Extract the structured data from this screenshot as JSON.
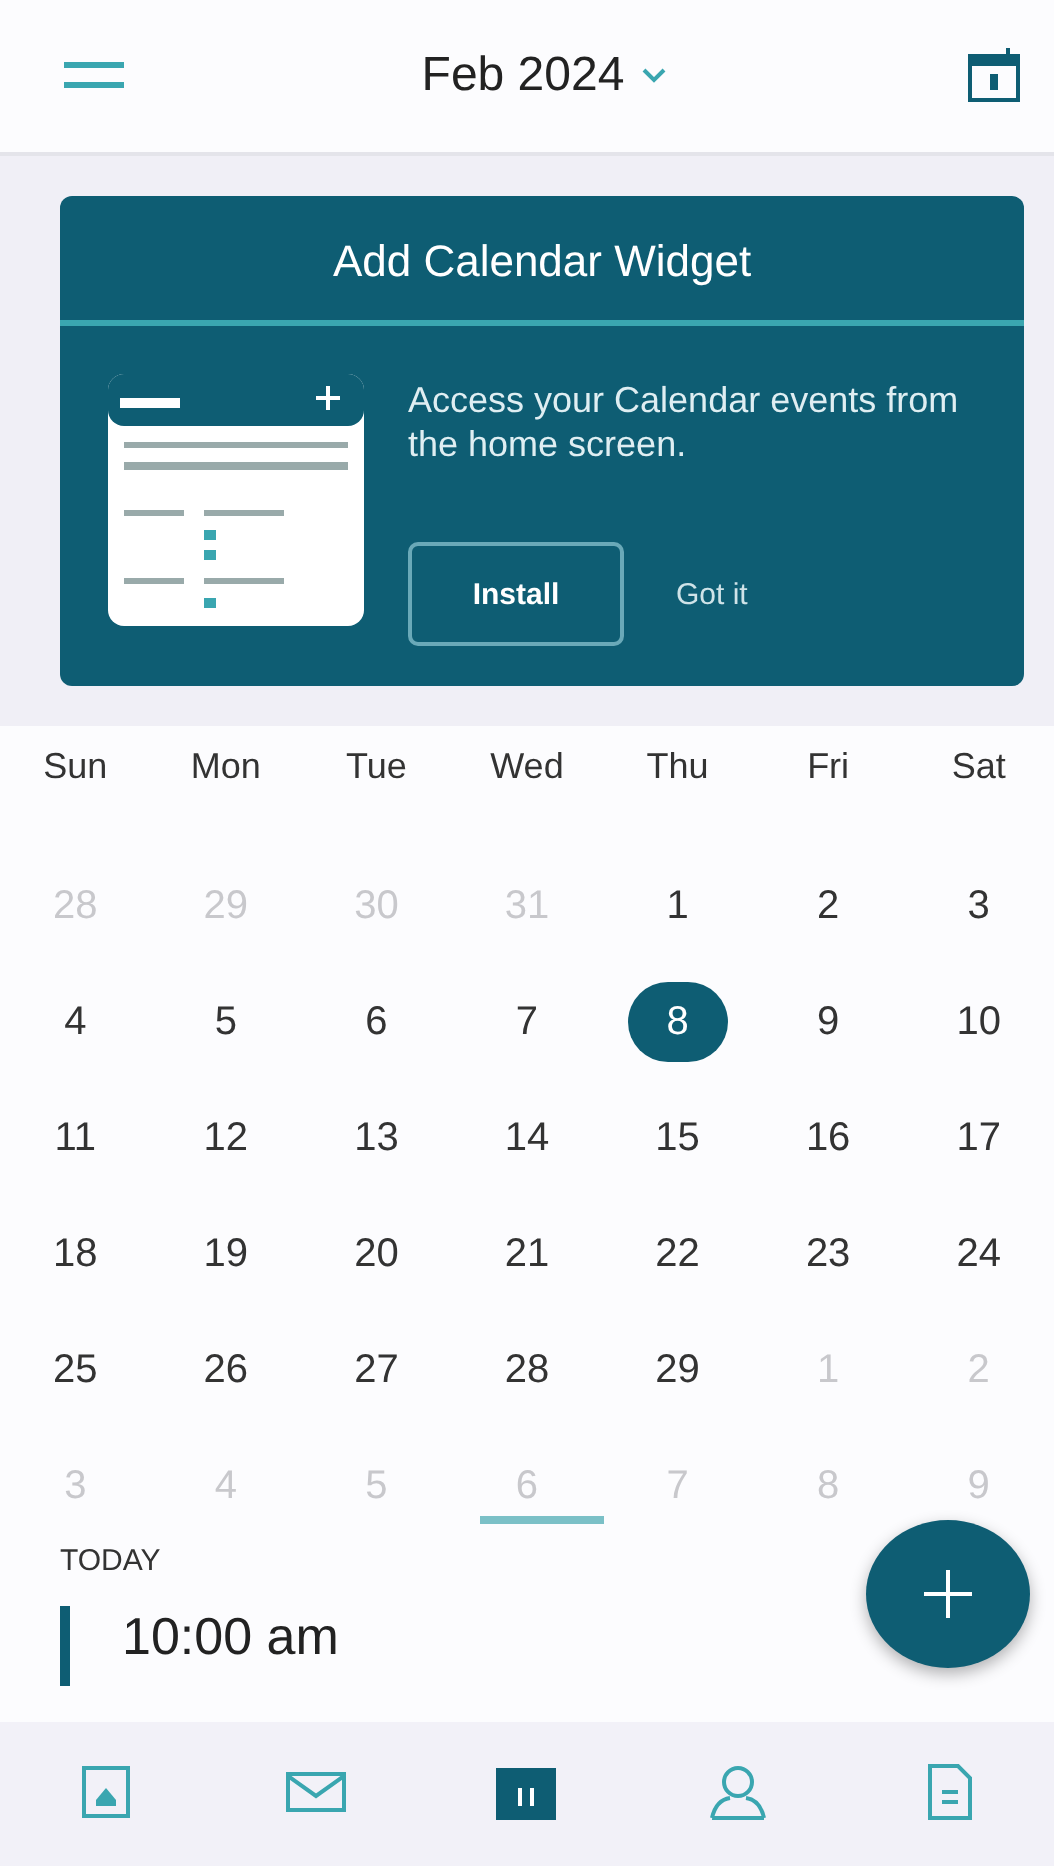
{
  "header": {
    "title": "Feb 2024"
  },
  "widget_card": {
    "title": "Add Calendar Widget",
    "description": "Access your Calendar events from the home screen.",
    "install_button": "Install",
    "dismiss_button": "Got it"
  },
  "weekdays": [
    "Sun",
    "Mon",
    "Tue",
    "Wed",
    "Thu",
    "Fri",
    "Sat"
  ],
  "weeks": [
    [
      {
        "day": "28",
        "muted": true,
        "selected": false
      },
      {
        "day": "29",
        "muted": true,
        "selected": false
      },
      {
        "day": "30",
        "muted": true,
        "selected": false
      },
      {
        "day": "31",
        "muted": true,
        "selected": false
      },
      {
        "day": "1",
        "muted": false,
        "selected": false
      },
      {
        "day": "2",
        "muted": false,
        "selected": false
      },
      {
        "day": "3",
        "muted": false,
        "selected": false
      }
    ],
    [
      {
        "day": "4",
        "muted": false,
        "selected": false
      },
      {
        "day": "5",
        "muted": false,
        "selected": false
      },
      {
        "day": "6",
        "muted": false,
        "selected": false
      },
      {
        "day": "7",
        "muted": false,
        "selected": false
      },
      {
        "day": "8",
        "muted": false,
        "selected": true
      },
      {
        "day": "9",
        "muted": false,
        "selected": false
      },
      {
        "day": "10",
        "muted": false,
        "selected": false
      }
    ],
    [
      {
        "day": "11",
        "muted": false,
        "selected": false
      },
      {
        "day": "12",
        "muted": false,
        "selected": false
      },
      {
        "day": "13",
        "muted": false,
        "selected": false
      },
      {
        "day": "14",
        "muted": false,
        "selected": false
      },
      {
        "day": "15",
        "muted": false,
        "selected": false
      },
      {
        "day": "16",
        "muted": false,
        "selected": false
      },
      {
        "day": "17",
        "muted": false,
        "selected": false
      }
    ],
    [
      {
        "day": "18",
        "muted": false,
        "selected": false
      },
      {
        "day": "19",
        "muted": false,
        "selected": false
      },
      {
        "day": "20",
        "muted": false,
        "selected": false
      },
      {
        "day": "21",
        "muted": false,
        "selected": false
      },
      {
        "day": "22",
        "muted": false,
        "selected": false
      },
      {
        "day": "23",
        "muted": false,
        "selected": false
      },
      {
        "day": "24",
        "muted": false,
        "selected": false
      }
    ],
    [
      {
        "day": "25",
        "muted": false,
        "selected": false
      },
      {
        "day": "26",
        "muted": false,
        "selected": false
      },
      {
        "day": "27",
        "muted": false,
        "selected": false
      },
      {
        "day": "28",
        "muted": false,
        "selected": false
      },
      {
        "day": "29",
        "muted": false,
        "selected": false
      },
      {
        "day": "1",
        "muted": true,
        "selected": false
      },
      {
        "day": "2",
        "muted": true,
        "selected": false
      }
    ],
    [
      {
        "day": "3",
        "muted": true,
        "selected": false
      },
      {
        "day": "4",
        "muted": true,
        "selected": false
      },
      {
        "day": "5",
        "muted": true,
        "selected": false
      },
      {
        "day": "6",
        "muted": true,
        "selected": false
      },
      {
        "day": "7",
        "muted": true,
        "selected": false
      },
      {
        "day": "8",
        "muted": true,
        "selected": false
      },
      {
        "day": "9",
        "muted": true,
        "selected": false
      }
    ]
  ],
  "agenda": {
    "section": "TODAY",
    "event_time": "10:00 am"
  },
  "bottom_nav": [
    {
      "kind": "home",
      "selected": false
    },
    {
      "kind": "mail",
      "selected": false
    },
    {
      "kind": "calendar",
      "selected": true
    },
    {
      "kind": "contacts",
      "selected": false
    },
    {
      "kind": "files",
      "selected": false
    }
  ]
}
